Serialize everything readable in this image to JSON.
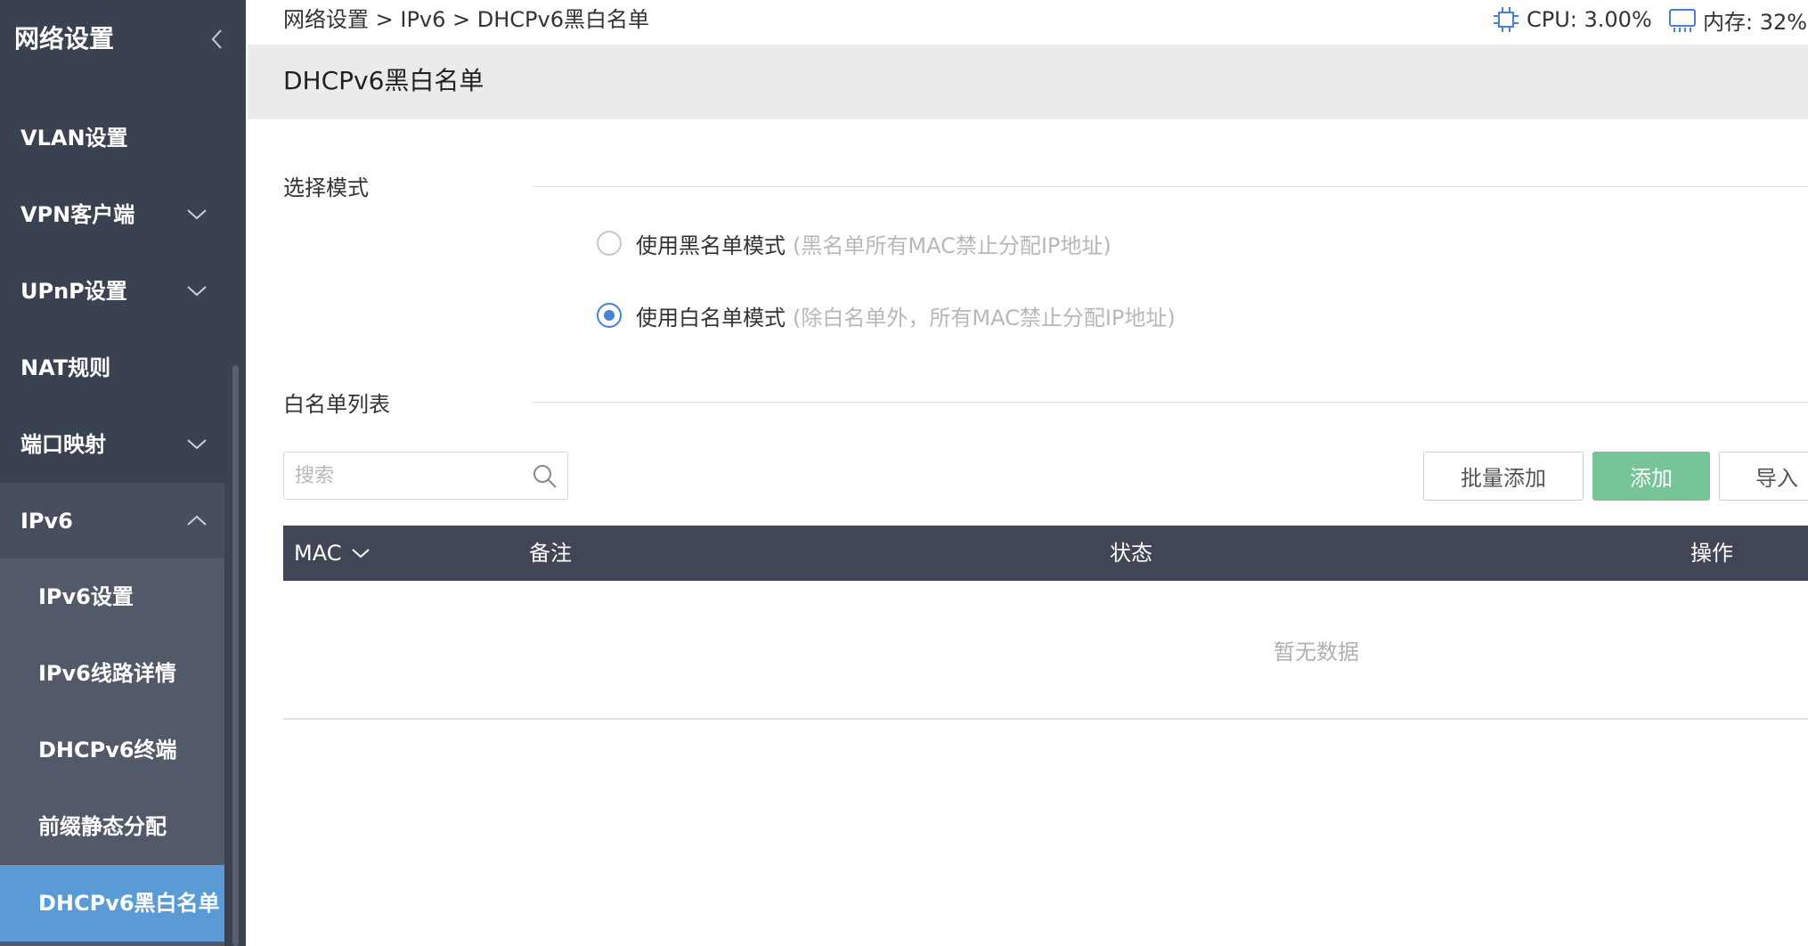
{
  "sidebar": {
    "title": "网络设置",
    "items": [
      {
        "label": "VLAN设置"
      },
      {
        "label": "VPN客户端"
      },
      {
        "label": "UPnP设置"
      },
      {
        "label": "NAT规则"
      },
      {
        "label": "端口映射"
      },
      {
        "label": "IPv6"
      }
    ],
    "subitems": [
      {
        "label": "IPv6设置"
      },
      {
        "label": "IPv6线路详情"
      },
      {
        "label": "DHCPv6终端"
      },
      {
        "label": "前缀静态分配"
      },
      {
        "label": "DHCPv6黑白名单"
      }
    ]
  },
  "header": {
    "breadcrumb": "网络设置 > IPv6 > DHCPv6黑白名单",
    "cpu": "CPU: 3.00%",
    "memory": "内存: 32%"
  },
  "page": {
    "title": "DHCPv6黑白名单"
  },
  "mode_section": {
    "title": "选择模式",
    "options": [
      {
        "label": "使用黑名单模式",
        "hint": "(黑名单所有MAC禁止分配IP地址)",
        "checked": false
      },
      {
        "label": "使用白名单模式",
        "hint": "(除白名单外，所有MAC禁止分配IP地址)",
        "checked": true
      }
    ]
  },
  "list_section": {
    "title": "白名单列表",
    "search_placeholder": "搜索",
    "buttons": {
      "batch_add": "批量添加",
      "add": "添加",
      "import": "导入"
    },
    "columns": [
      "MAC",
      "备注",
      "状态",
      "操作"
    ],
    "empty_text": "暂无数据"
  },
  "colors": {
    "sidebar_bg": "#3a4252",
    "active_item": "#5b9bd5",
    "add_button": "#76c497",
    "table_header": "#414656",
    "radio_accent": "#4a7fd6"
  }
}
